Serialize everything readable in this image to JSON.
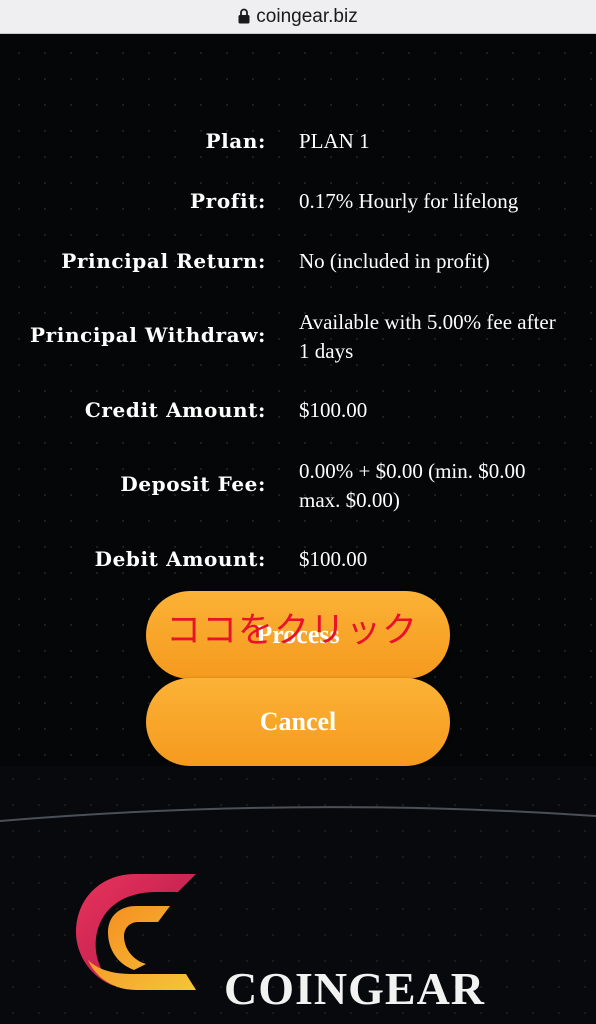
{
  "browser": {
    "url": "coingear.biz"
  },
  "details": [
    {
      "label": "Plan:",
      "value": "PLAN 1"
    },
    {
      "label": "Profit:",
      "value": "0.17% Hourly for lifelong"
    },
    {
      "label": "Principal Return:",
      "value": "No (included in profit)"
    },
    {
      "label": "Principal Withdraw:",
      "value": "Available with 5.00% fee after 1 days"
    },
    {
      "label": "Credit Amount:",
      "value": "$100.00"
    },
    {
      "label": "Deposit Fee:",
      "value": "0.00% + $0.00 (min. $0.00 max. $0.00)"
    },
    {
      "label": "Debit Amount:",
      "value": "$100.00"
    }
  ],
  "buttons": {
    "process": "Process",
    "cancel": "Cancel"
  },
  "annotation": "ココをクリック",
  "footer": {
    "brand": "COINGEAR"
  },
  "colors": {
    "button": "#f9a62b",
    "annotation": "#e8132a",
    "background": "#050607"
  },
  "icons": {
    "lock": "lock-icon",
    "logo": "coingear-logo-icon"
  }
}
